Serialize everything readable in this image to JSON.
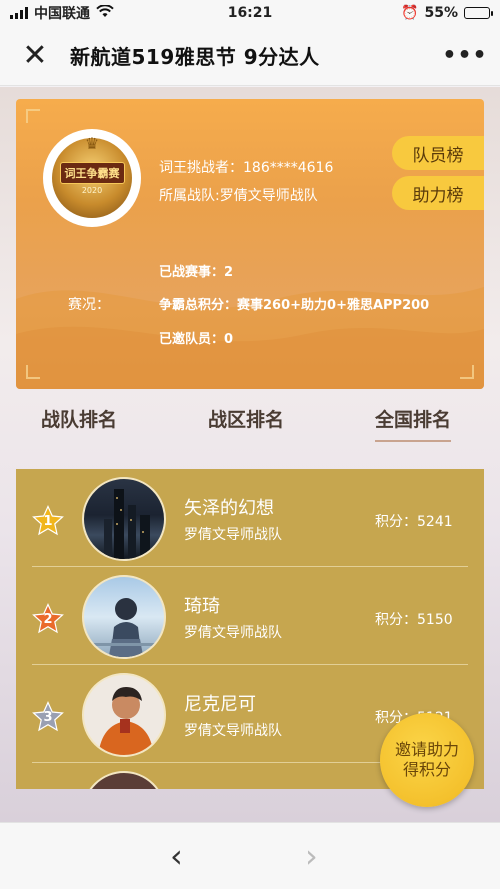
{
  "status_bar": {
    "carrier": "中国联通",
    "time": "16:21",
    "battery": "55%",
    "battery_level": 0.55
  },
  "nav": {
    "title": "新航道519雅思节 9分达人",
    "close_icon": "close-icon",
    "more_icon": "more-icon"
  },
  "profile": {
    "badge_text": "词王争霸赛",
    "badge_year": "2020",
    "challenger": "词王挑战者：186****4616",
    "team": "所属战队:罗倩文导师战队",
    "stats_label": "赛况：",
    "battles": "已战赛事：2",
    "total_points": "争霸总积分：赛事260+助力0+雅思APP200",
    "invited": "已邀队员：0"
  },
  "side_tabs": {
    "team_rank": "队员榜",
    "help_rank": "助力榜"
  },
  "rank_tabs": [
    "战队排名",
    "战区排名",
    "全国排名"
  ],
  "active_rank_tab": "全国排名",
  "ranking": [
    {
      "rank": "1",
      "name": "矢泽的幻想",
      "team": "罗倩文导师战队",
      "score": "积分：5241",
      "star_color": "#f1b61d"
    },
    {
      "rank": "2",
      "name": "琦琦",
      "team": "罗倩文导师战队",
      "score": "积分：5150",
      "star_color": "#ea6a2b"
    },
    {
      "rank": "3",
      "name": "尼克尼可",
      "team": "罗倩文导师战队",
      "score": "积分：5121",
      "star_color": "#9aa0b2"
    }
  ],
  "invite_button": {
    "line1": "邀请助力",
    "line2": "得积分"
  },
  "colors": {
    "card": "#eba14b",
    "list_bg": "#c6a64f",
    "tab_yellow": "#f8c93e"
  }
}
